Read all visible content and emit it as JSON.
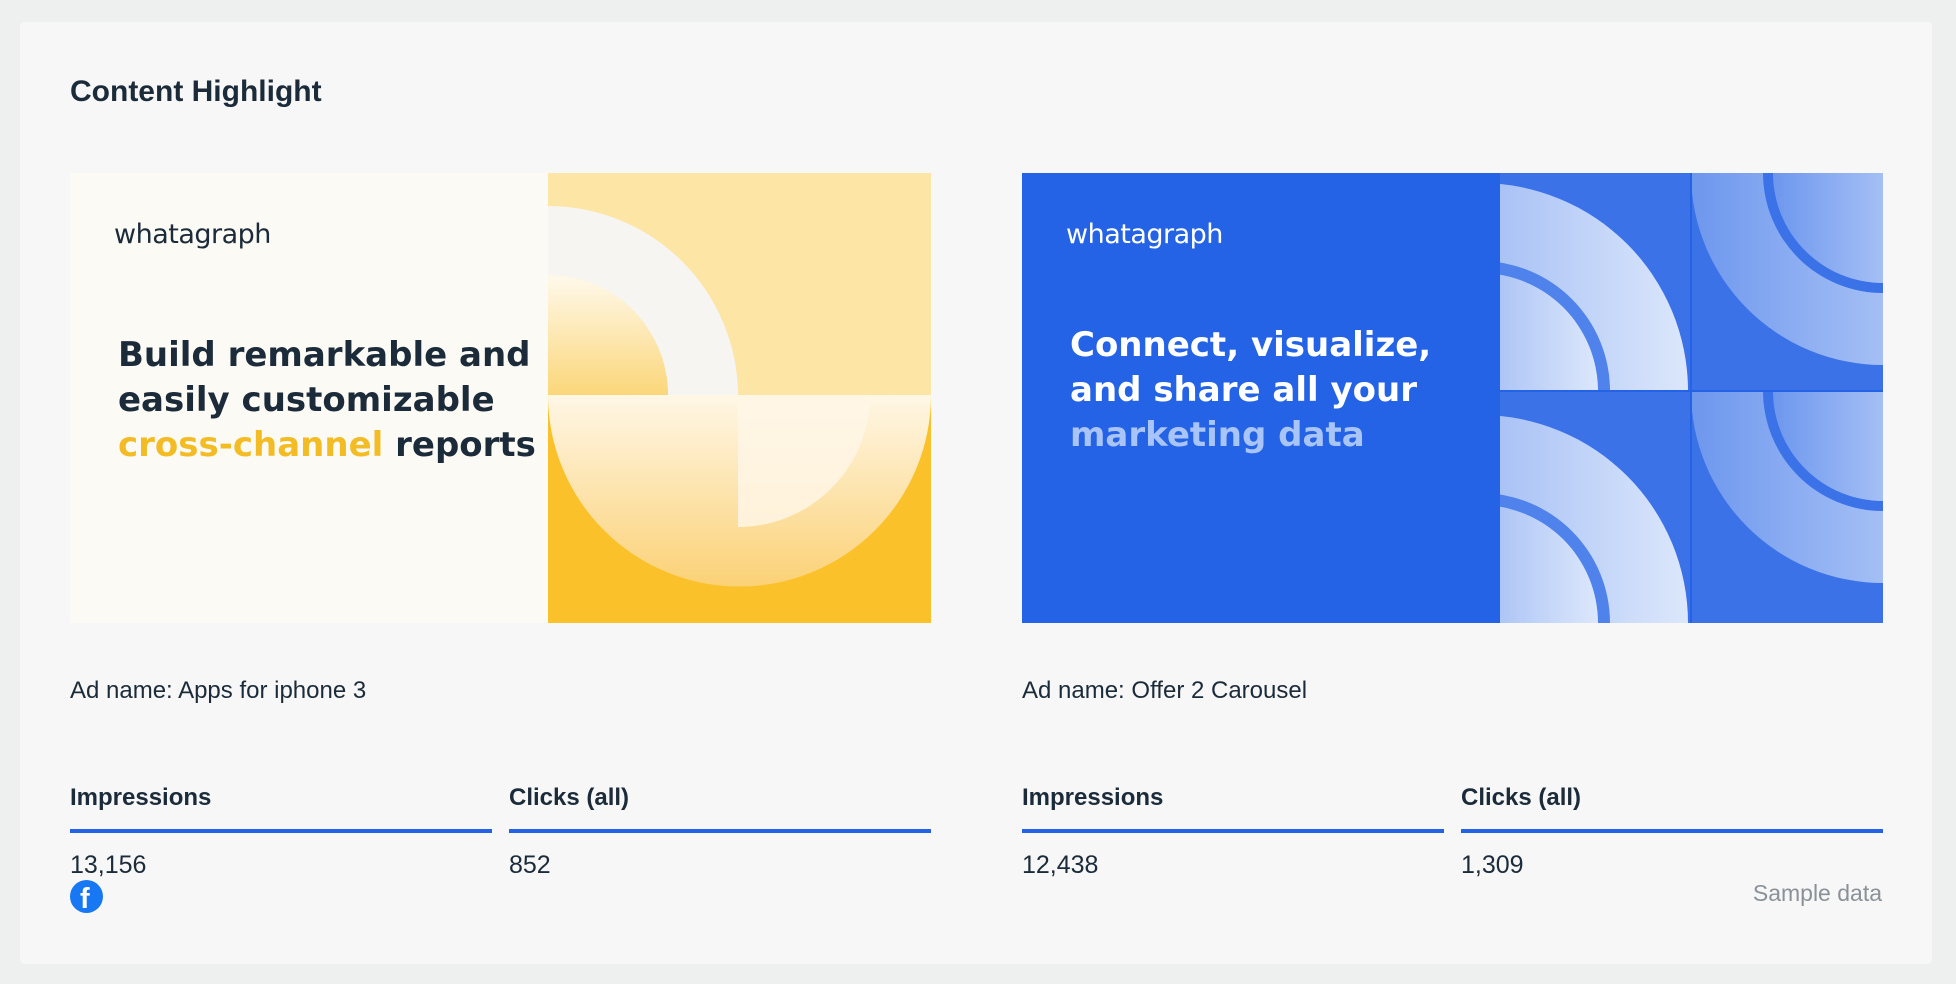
{
  "widget": {
    "title": "Content Highlight",
    "sample_label": "Sample data"
  },
  "ads": [
    {
      "brand": "whatagraph",
      "headline_pre": "Build remarkable and easily customizable",
      "headline_highlight": "cross-channel",
      "headline_post": " reports",
      "name": "Ad name: Apps for iphone 3",
      "metrics": [
        {
          "label": "Impressions",
          "value": "13,156"
        },
        {
          "label": "Clicks (all)",
          "value": "852"
        }
      ]
    },
    {
      "brand": "whatagraph",
      "headline_pre": "Connect, visualize, and share all your",
      "headline_highlight": "marketing data",
      "headline_post": "",
      "name": "Ad name: Offer 2 Carousel",
      "metrics": [
        {
          "label": "Impressions",
          "value": "12,438"
        },
        {
          "label": "Clicks (all)",
          "value": "1,309"
        }
      ]
    }
  ],
  "icons": {
    "source": "facebook-icon"
  },
  "colors": {
    "accent": "#2563e6",
    "highlight_yellow": "#f4bc24",
    "ad2_background": "#2563e6"
  }
}
